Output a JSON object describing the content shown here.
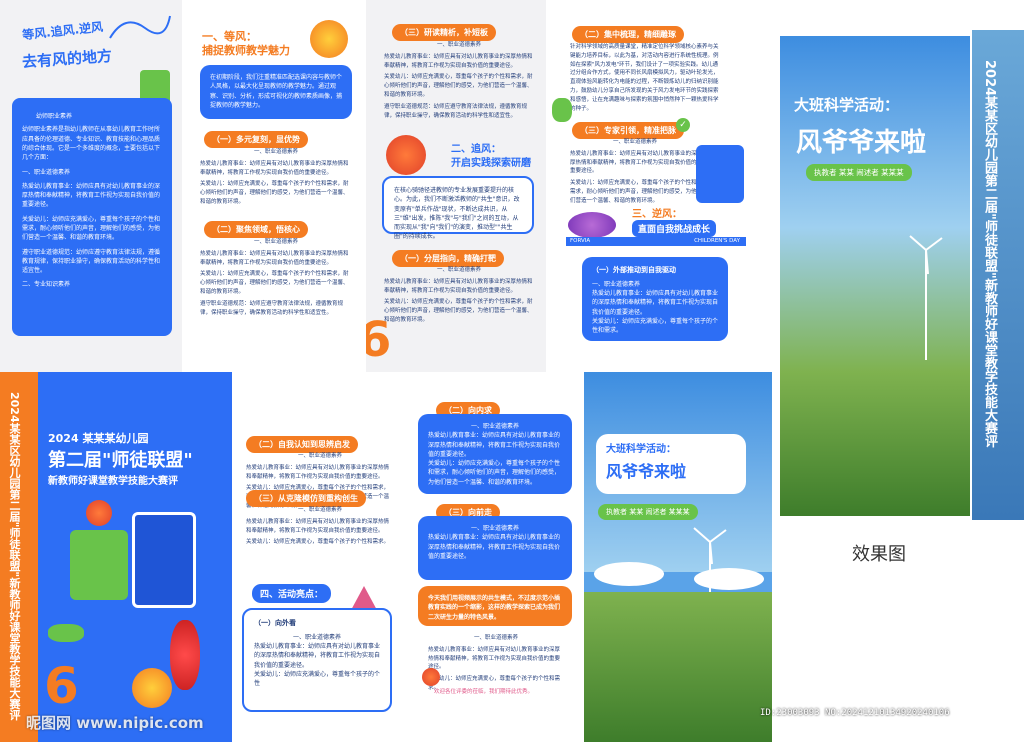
{
  "colors": {
    "blue": "#2d6ef5",
    "orange": "#f47c22",
    "green": "#69c34a",
    "pink": "#e05a8a",
    "bg": "#f2f2f2"
  },
  "top": {
    "p1": {
      "slogan": "等风.追风.逆风",
      "slogan2": "去有风的地方",
      "card_title": "幼师职业素养",
      "card_body": "幼师职业素养是指幼儿教师在从事幼儿教育工作时所应具备的伦理道德、专业知识、教育技能和心理品质的综合体现。它是一个多维度的概念，主要包括以下几个方面：",
      "card_s1": "一、职业道德素养",
      "card_s1_body": "热爱幼儿教育事业：幼师应具有对幼儿教育事业的深厚热情和奉献精神，将教育工作视为实现自我价值的重要途径。",
      "card_s2_body": "关爱幼儿：幼师应充满爱心，尊重每个孩子的个性和需求，耐心倾听他们的声音，理解他们的感受，为他们营造一个温馨、和谐的教育环境。",
      "card_s3_body": "遵守职业道德规范：幼师应遵守教育法律法规，遵循教育规律，保持职业操守，确保教育活动的科学性和适宜性。",
      "card_s4": "二、专业知识素养"
    },
    "p2": {
      "h1": "一、等风：",
      "h1b": "捕捉教师教学魅力",
      "intro": "在初期阶段，我们注重精准匹配选课内容与教师个人风格，以最大化呈现教师的教学魅力。通过观察、识别、分析，形成可视化的教师素质画像，捕捉教师的教学魅力。",
      "t1": "（一）多元复刻，显优势",
      "t1a": "一、职业道德素养",
      "t1b": "热爱幼儿教育事业：幼师应具有对幼儿教育事业的深厚热情和奉献精神，将教育工作视为实现自我价值的重要途径。",
      "t1c": "关爱幼儿：幼师应充满爱心，尊重每个孩子的个性和需求，耐心倾听他们的声音，理解他们的感受，为他们营造一个温馨、和谐的教育环境。",
      "t2": "（二）聚焦领域，悟核心",
      "t2a": "一、职业道德素养",
      "t2b": "热爱幼儿教育事业：幼师应具有对幼儿教育事业的深厚热情和奉献精神，将教育工作视为实现自我价值的重要途径。",
      "t2c": "关爱幼儿：幼师应充满爱心，尊重每个孩子的个性和需求，耐心倾听他们的声音，理解他们的感受，为他们营造一个温馨、和谐的教育环境。",
      "t2d": "遵守职业道德规范：幼师应遵守教育法律法规，遵循教育规律，保持职业操守，确保教育活动的科学性和适宜性。"
    },
    "p3": {
      "t1": "（三）研读精析，补短板",
      "t1a": "一、职业道德素养",
      "t1b": "热爱幼儿教育事业：幼师应具有对幼儿教育事业的深厚热情和奉献精神，将教育工作视为实现自我价值的重要途径。",
      "t1c": "关爱幼儿：幼师应充满爱心，尊重每个孩子的个性和需求，耐心倾听他们的声音，理解他们的感受，为他们营造一个温馨、和谐的教育环境。",
      "t1d": "遵守职业道德规范：幼师应遵守教育法律法规，遵循教育规律，保持职业操守，确保教育活动的科学性和适宜性。",
      "h2": "二、追风：",
      "h2b": "开启实践探索研磨",
      "intro": "在核心骑驰径进教师的专业发展重要提升的核心。为此，我们不断激活教师的\"共生\"意识，改变原有\"单兵作战\"现状，不断达成共识，从三\"维\"出发，推陈\"我\"与\"我们\"之间的互动，从而实现从\"我\"向\"我们\"的演变，推动型\"\"共生圈\"的持续成长。",
      "t2": "（一）分层指向，精确打靶",
      "t2a": "一、职业道德素养",
      "t2b": "热爱幼儿教育事业：幼师应具有对幼儿教育事业的深厚热情和奉献精神，将教育工作视为实现自我价值的重要途径。",
      "t2c": "关爱幼儿：幼师应充满爱心，尊重每个孩子的个性和需求，耐心倾听他们的声音，理解他们的感受，为他们营造一个温馨、和谐的教育环境。"
    },
    "p4": {
      "t1": "（二）集中梳理，精细雕琢",
      "t1a": "针对科学领域的高质量课堂，精准定位科学领域核心素养与关键能力培养目标，以此为基，对活动内容进行系统性梳理。例如在探索\"风力发电\"环节，我们设计了一项实验实践。幼儿通过分组合作方式，使用不同长风扇模拟风力，驱动叶轮发光，直观体验风能转化为电能的过程，不断锻炼幼儿的归纳识别能力，鼓励幼儿分享自己所发现的关于风力发电环节的实践探索和感悟，让在充满趣味与探索的氛围中悄然种下一颗热爱科学的种子。",
      "t2": "（三）专家引领，精准把脉",
      "t2a": "一、职业道德素养",
      "t2b": "热爱幼儿教育事业：幼师应具有对幼儿教育事业的深厚热情和奉献精神，将教育工作视为实现自我价值的重要途径。",
      "t2c": "关爱幼儿：幼师应充满爱心，尊重每个孩子的个性和需求，耐心倾听他们的声音，理解他们的感受，为他们营造一个温馨、和谐的教育环境。",
      "h3": "三、逆风：",
      "h3b": "直面自我挑战成长",
      "bar_left": "FORVIA",
      "bar_right": "CHILDREN'S DAY",
      "t3": "（一）外部推动到自我驱动",
      "t3a": "一、职业道德素养",
      "t3b": "热爱幼儿教育事业：幼师应具有对幼儿教育事业的深厚热情和奉献精神，将教育工作视为实现自我价值的重要途径。",
      "t3c": "关爱幼儿：幼师应充满爱心，尊重每个孩子的个性和需求。"
    }
  },
  "bottom": {
    "cover": {
      "vert_title": "2024某某区幼儿园第二届\"师徒联盟\"新教师好课堂教学技能大赛评",
      "line1": "2024 某某某幼儿园",
      "line2": "第二届\"师徒联盟\"",
      "line3": "新教师好课堂教学技能大赛评"
    },
    "p6": {
      "t1": "（二）自我认知到思辨启发",
      "t1a": "一、职业道德素养",
      "t1b": "热爱幼儿教育事业：幼师应具有对幼儿教育事业的深厚热情和奉献精神，将教育工作视为实现自我价值的重要途径。",
      "t1c": "关爱幼儿：幼师应充满爱心，尊重每个孩子的个性和需求，耐心倾听他们的声音，理解他们的感受，为他们营造一个温馨、和谐的教育环境。",
      "t2": "（三）从克隆模仿到重构创生",
      "t2a": "一、职业道德素养",
      "t2b": "热爱幼儿教育事业：幼师应具有对幼儿教育事业的深厚热情和奉献精神，将教育工作视为实现自我价值的重要途径。",
      "t2c": "关爱幼儿：幼师应充满爱心，尊重每个孩子的个性和需求。",
      "h4": "四、活动亮点：",
      "t3": "（一）向外看",
      "t3a": "一、职业道德素养",
      "t3b": "热爱幼儿教育事业：幼师应具有对幼儿教育事业的深厚热情和奉献精神，将教育工作视为实现自我价值的重要途径。",
      "t3c": "关爱幼儿：幼师应充满爱心，尊重每个孩子的个性"
    },
    "p7": {
      "t1": "（二）向内求",
      "t1a": "一、职业道德素养",
      "t1b": "热爱幼儿教育事业：幼师应具有对幼儿教育事业的深厚热情和奉献精神，将教育工作视为实现自我价值的重要途径。",
      "t1c": "关爱幼儿：幼师应充满爱心，尊重每个孩子的个性和需求，耐心倾听他们的声音，理解他们的感受，为他们营造一个温馨、和谐的教育环境。",
      "t2": "（三）向前走",
      "t2a": "一、职业道德素养",
      "t2b": "热爱幼儿教育事业：幼师应具有对幼儿教育事业的深厚热情和奉献精神，将教育工作视为实现自我价值的重要途径。",
      "box": "今天我们用视频展示的共生模式，不过度示范小插教育实践的一个缩影，这样的教学探索已成为我们二次研生力量的特色风景。",
      "t3a": "一、职业道德素养",
      "t3b": "热爱幼儿教育事业：幼师应具有对幼儿教育事业的深厚热情和奉献精神，将教育工作视为实现自我价值的重要途径。",
      "t3c": "关爱幼儿：幼师应充满爱心，尊重每个孩子的个性和需求。",
      "footer": "欢迎各位评委的莅临，我们期待此优秀。"
    },
    "p8": {
      "title1": "大班科学活动：",
      "title2": "风爷爷来啦",
      "credits": "执教者 某某   闹述者 某某某"
    }
  },
  "mockup": {
    "title1": "大班科学活动：",
    "title2": "风爷爷来啦",
    "credits": "执教者 某某   闹述者 某某某",
    "spine": "2024某某区幼儿园第二届\"师徒联盟\"新教师好课堂教学技能大赛评",
    "caption": "效果图"
  },
  "watermark": {
    "site": "昵图网 www.nipic.com",
    "id": "ID:23003093 NO:20241210134920240106"
  }
}
